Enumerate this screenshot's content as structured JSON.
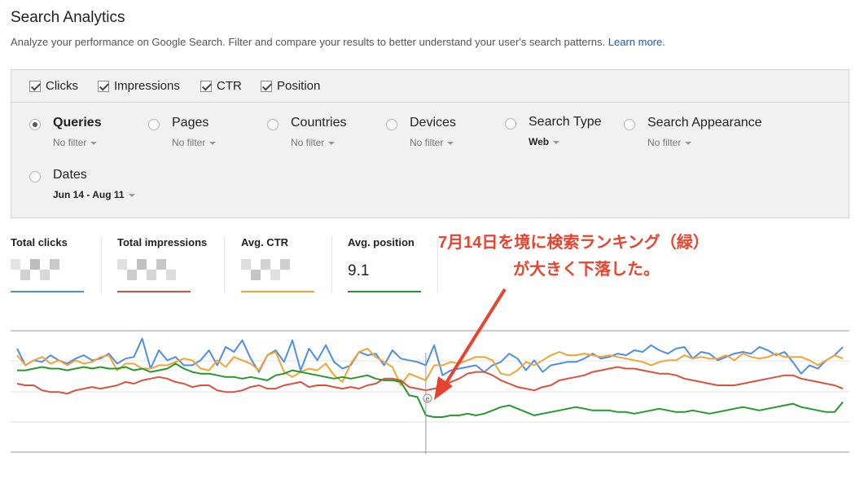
{
  "header": {
    "title": "Search Analytics",
    "subtitle": "Analyze your performance on Google Search. Filter and compare your results to better understand your user's search patterns.",
    "learn_more": "Learn more."
  },
  "metric_toggles": [
    {
      "label": "Clicks",
      "checked": true
    },
    {
      "label": "Impressions",
      "checked": true
    },
    {
      "label": "CTR",
      "checked": true
    },
    {
      "label": "Position",
      "checked": true
    }
  ],
  "dimensions": [
    {
      "label": "Queries",
      "filter": "No filter",
      "selected": true
    },
    {
      "label": "Pages",
      "filter": "No filter",
      "selected": false
    },
    {
      "label": "Countries",
      "filter": "No filter",
      "selected": false
    },
    {
      "label": "Devices",
      "filter": "No filter",
      "selected": false
    },
    {
      "label": "Search Type",
      "filter": "Web",
      "selected": false
    },
    {
      "label": "Search Appearance",
      "filter": "No filter",
      "selected": false
    },
    {
      "label": "Dates",
      "filter": "Jun 14 - Aug 11",
      "selected": false
    }
  ],
  "metrics": [
    {
      "label": "Total clicks",
      "value": "",
      "color": "#4d8ee8"
    },
    {
      "label": "Total impressions",
      "value": "",
      "color": "#d9513c"
    },
    {
      "label": "Avg. CTR",
      "value": "",
      "color": "#f4a331"
    },
    {
      "label": "Avg. position",
      "value": "9.1",
      "color": "#25982c"
    }
  ],
  "annotation": {
    "line1": "7月14日を境に検索ランキング（緑）",
    "line2": "が大きく下落した。",
    "color": "#e8432f"
  },
  "chart_data": {
    "type": "line",
    "marker_label": "e",
    "series": [
      {
        "color": "#4d8ee8",
        "values": [
          62,
          52,
          55,
          54,
          58,
          55,
          53,
          56,
          58,
          55,
          56,
          59,
          53,
          56,
          57,
          68,
          50,
          61,
          55,
          57,
          52,
          52,
          55,
          61,
          52,
          63,
          60,
          67,
          56,
          48,
          58,
          61,
          54,
          67,
          49,
          62,
          55,
          64,
          54,
          50,
          52,
          60,
          58,
          59,
          52,
          61,
          56,
          55,
          54,
          52,
          64,
          46,
          49,
          50,
          51,
          52,
          48,
          52,
          54,
          59,
          56,
          49,
          55,
          48,
          52,
          53,
          54,
          54,
          56,
          59,
          56,
          57,
          59,
          58,
          61,
          60,
          64,
          61,
          59,
          62,
          63,
          56,
          60,
          59,
          55,
          57,
          59,
          60,
          59,
          63,
          61,
          58,
          60,
          54,
          47,
          52,
          50,
          55,
          58,
          63
        ]
      },
      {
        "color": "#f4a331",
        "values": [
          58,
          52,
          55,
          57,
          53,
          55,
          52,
          55,
          53,
          54,
          57,
          58,
          49,
          53,
          53,
          50,
          50,
          52,
          52,
          54,
          56,
          55,
          50,
          49,
          55,
          51,
          57,
          55,
          53,
          49,
          58,
          60,
          48,
          45,
          48,
          50,
          49,
          53,
          46,
          42,
          53,
          60,
          62,
          57,
          54,
          51,
          40,
          47,
          45,
          43,
          52,
          52,
          54,
          53,
          55,
          57,
          57,
          55,
          47,
          46,
          49,
          54,
          52,
          55,
          58,
          60,
          58,
          58,
          59,
          58,
          57,
          58,
          57,
          56,
          55,
          54,
          52,
          54,
          55,
          55,
          58,
          56,
          57,
          56,
          56,
          58,
          55,
          59,
          57,
          56,
          57,
          59,
          57,
          57,
          57,
          55,
          52,
          55,
          58,
          56
        ]
      },
      {
        "color": "#d9513c",
        "values": [
          41,
          40,
          40,
          37,
          36,
          36,
          35,
          37,
          38,
          39,
          38,
          39,
          40,
          42,
          41,
          43,
          44,
          45,
          44,
          42,
          41,
          39,
          40,
          40,
          37,
          36,
          36,
          37,
          39,
          40,
          38,
          38,
          40,
          41,
          42,
          39,
          40,
          40,
          39,
          38,
          39,
          38,
          40,
          41,
          44,
          44,
          43,
          39,
          38,
          37,
          38,
          39,
          42,
          44,
          47,
          48,
          48,
          46,
          43,
          41,
          39,
          38,
          37,
          39,
          40,
          43,
          44,
          45,
          46,
          48,
          49,
          50,
          51,
          50,
          50,
          49,
          48,
          47,
          47,
          46,
          44,
          43,
          42,
          41,
          40,
          40,
          40,
          41,
          42,
          43,
          44,
          45,
          46,
          46,
          44,
          43,
          42,
          41,
          40,
          38
        ]
      },
      {
        "color": "#25982c",
        "values": [
          49,
          49,
          50,
          51,
          50,
          50,
          49,
          50,
          51,
          50,
          51,
          50,
          50,
          51,
          49,
          50,
          48,
          49,
          50,
          53,
          50,
          48,
          47,
          47,
          46,
          45,
          45,
          44,
          45,
          44,
          43,
          46,
          47,
          49,
          48,
          47,
          46,
          45,
          44,
          45,
          44,
          45,
          46,
          44,
          43,
          43,
          42,
          34,
          33,
          22,
          21,
          21,
          22,
          22,
          23,
          22,
          23,
          25,
          27,
          28,
          26,
          24,
          22,
          23,
          24,
          25,
          26,
          27,
          26,
          25,
          25,
          25,
          24,
          24,
          23,
          24,
          25,
          26,
          25,
          24,
          24,
          25,
          24,
          23,
          24,
          25,
          26,
          27,
          26,
          25,
          26,
          27,
          28,
          29,
          27,
          26,
          25,
          24,
          24,
          30
        ]
      }
    ],
    "marker_index": 49
  }
}
